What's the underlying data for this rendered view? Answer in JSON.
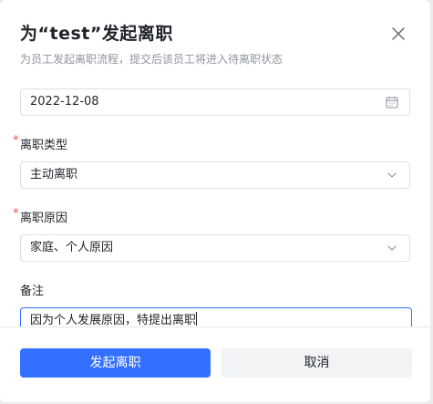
{
  "dialog": {
    "title": "为“test”发起离职",
    "subtitle": "为员工发起离职流程，提交后该员工将进入待离职状态"
  },
  "form": {
    "date": {
      "value": "2022-12-08",
      "icon": "calendar-icon"
    },
    "type": {
      "label": "离职类型",
      "required_mark": "*",
      "value": "主动离职",
      "icon": "chevron-down-icon"
    },
    "reason": {
      "label": "离职原因",
      "required_mark": "*",
      "value": "家庭、个人原因",
      "icon": "chevron-down-icon"
    },
    "remark": {
      "label": "备注",
      "value": "因为个人发展原因，特提出离职"
    }
  },
  "actions": {
    "submit_label": "发起离职",
    "cancel_label": "取消"
  },
  "colors": {
    "primary": "#3370ff",
    "required": "#f54a45",
    "secondary_bg": "#f2f3f5"
  }
}
